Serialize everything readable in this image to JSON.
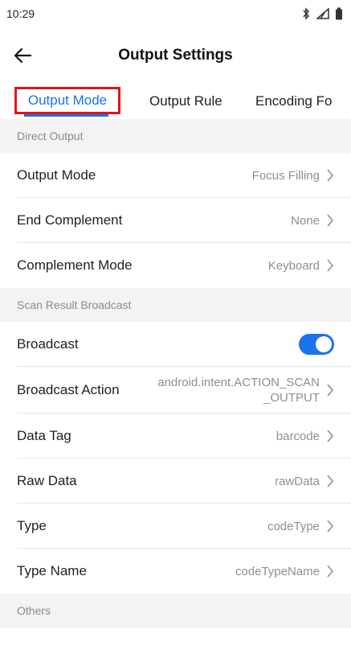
{
  "status_bar": {
    "time": "10:29",
    "icons": [
      "bluetooth-icon",
      "signal-icon",
      "battery-icon"
    ]
  },
  "app_bar": {
    "title": "Output Settings",
    "back_icon": "arrow-left-icon"
  },
  "tabs": [
    {
      "label": "Output Mode",
      "active": true
    },
    {
      "label": "Output Rule",
      "active": false
    },
    {
      "label": "Encoding Fo",
      "active": false
    }
  ],
  "sections": {
    "direct_output": {
      "header": "Direct Output",
      "rows": {
        "output_mode": {
          "label": "Output Mode",
          "value": "Focus Filling"
        },
        "end_complement": {
          "label": "End Complement",
          "value": "None"
        },
        "complement_mode": {
          "label": "Complement Mode",
          "value": "Keyboard"
        }
      }
    },
    "broadcast": {
      "header": "Scan Result Broadcast",
      "rows": {
        "broadcast": {
          "label": "Broadcast",
          "enabled": true
        },
        "broadcast_action": {
          "label": "Broadcast Action",
          "value": "android.intent.ACTION_SCAN_OUTPUT"
        },
        "data_tag": {
          "label": "Data Tag",
          "value": "barcode"
        },
        "raw_data": {
          "label": "Raw Data",
          "value": "rawData"
        },
        "type": {
          "label": "Type",
          "value": "codeType"
        },
        "type_name": {
          "label": "Type Name",
          "value": "codeTypeName"
        }
      }
    },
    "others": {
      "header": "Others",
      "partial_toggle_enabled": true
    }
  },
  "colors": {
    "accent": "#1a73e8",
    "highlight_box": "#e3121a",
    "section_bg": "#f3f3f3",
    "secondary_text": "#8f8f8f"
  }
}
